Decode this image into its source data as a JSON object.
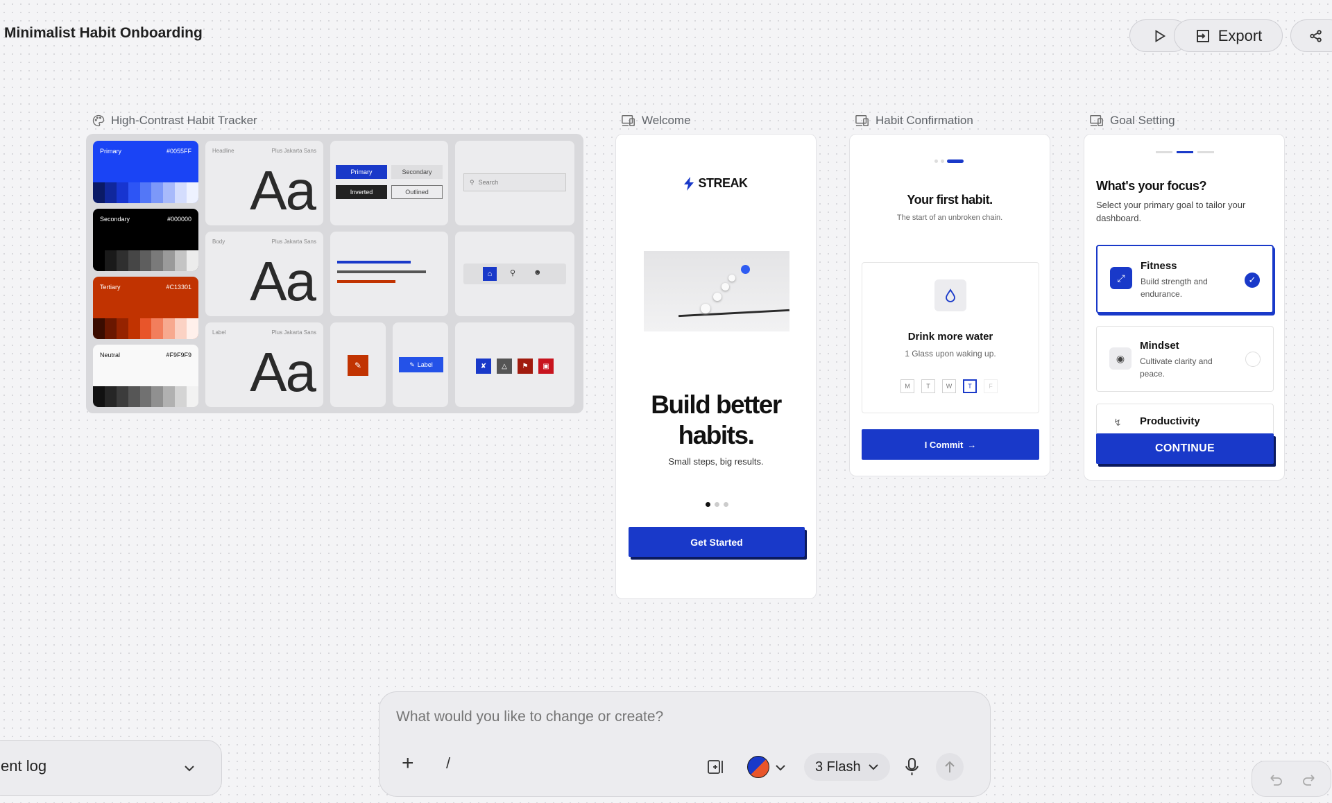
{
  "header": {
    "title": "Minimalist Habit Onboarding",
    "export_label": "Export"
  },
  "frames": {
    "design_system": {
      "label": "High-Contrast Habit Tracker",
      "swatches": [
        {
          "name": "Primary",
          "hex": "#0055FF"
        },
        {
          "name": "Secondary",
          "hex": "#000000"
        },
        {
          "name": "Tertiary",
          "hex": "#C13301"
        },
        {
          "name": "Neutral",
          "hex": "#F9F9F9"
        }
      ],
      "typography": [
        {
          "kind": "Headline",
          "font": "Plus Jakarta Sans",
          "sample": "Aa"
        },
        {
          "kind": "Body",
          "font": "Plus Jakarta Sans",
          "sample": "Aa"
        },
        {
          "kind": "Label",
          "font": "Plus Jakarta Sans",
          "sample": "Aa"
        }
      ],
      "buttons": {
        "primary": "Primary",
        "secondary": "Secondary",
        "inverted": "Inverted",
        "outlined": "Outlined"
      },
      "search_placeholder": "Search",
      "chip_label": "Label"
    },
    "welcome": {
      "label": "Welcome",
      "brand": "STREAK",
      "headline_line1": "Build better",
      "headline_line2": "habits.",
      "subhead": "Small steps, big results.",
      "cta": "Get Started"
    },
    "habit_confirmation": {
      "label": "Habit Confirmation",
      "title": "Your first habit.",
      "subtitle": "The start of an unbroken chain.",
      "habit_name": "Drink more water",
      "habit_desc": "1 Glass upon waking up.",
      "days": [
        "M",
        "T",
        "W",
        "T",
        "F"
      ],
      "cta": "I Commit"
    },
    "goal_setting": {
      "label": "Goal Setting",
      "title": "What's your focus?",
      "subtitle": "Select your primary goal to tailor your dashboard.",
      "goals": [
        {
          "name": "Fitness",
          "desc": "Build strength and endurance.",
          "selected": true
        },
        {
          "name": "Mindset",
          "desc": "Cultivate clarity and peace.",
          "selected": false
        },
        {
          "name": "Productivity",
          "desc": "",
          "selected": false
        }
      ],
      "cta": "CONTINUE"
    }
  },
  "composer": {
    "placeholder": "What would you like to change or create?",
    "slash": "/",
    "model": "3 Flash"
  },
  "event_log": {
    "label": "ent log"
  },
  "colors": {
    "accent": "#1939C9",
    "primary_swatch": "#0055FF",
    "tertiary_swatch": "#C13301"
  }
}
